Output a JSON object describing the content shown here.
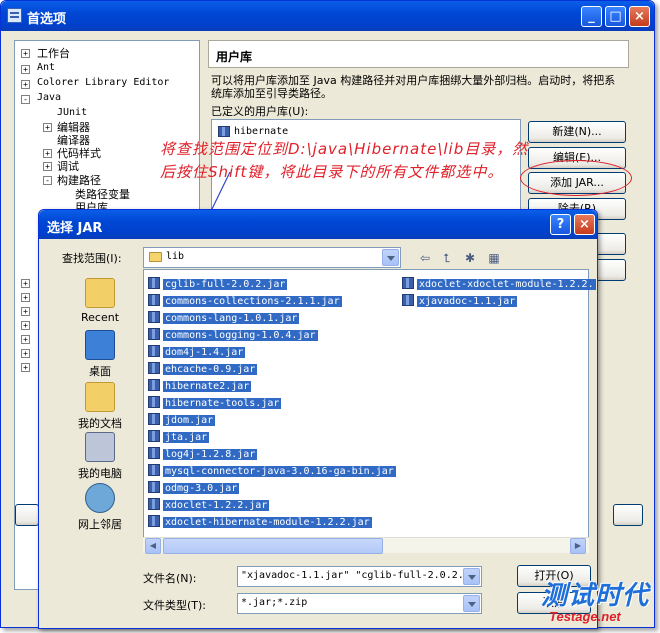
{
  "outer_window": {
    "title": "首选项",
    "tree": [
      {
        "label": "工作台",
        "expander": "+"
      },
      {
        "label": "Ant",
        "expander": "+"
      },
      {
        "label": "Colorer Library Editor",
        "expander": "+"
      },
      {
        "label": "Java",
        "expander": "-"
      },
      {
        "label": "JUnit",
        "expander": ""
      },
      {
        "label": "编辑器",
        "expander": "+"
      },
      {
        "label": "编译器",
        "expander": ""
      },
      {
        "label": "代码样式",
        "expander": "+"
      },
      {
        "label": "调试",
        "expander": "+"
      },
      {
        "label": "构建路径",
        "expander": "-"
      },
      {
        "label": "类路径变量",
        "expander": ""
      },
      {
        "label": "用户库",
        "expander": ""
      }
    ],
    "page_title": "用户库",
    "description": "可以将用户库添加至 Java 构建路径并对用户库捆绑大量外部归档。启动时，将把系统库添加至引导类路径。",
    "defined_libs_label": "已定义的用户库(U):",
    "libraries": [
      "hibernate"
    ],
    "buttons": {
      "new": "新建(N)...",
      "edit": "编辑(E)...",
      "add_jar": "添加 JAR...",
      "remove": "除去(R)"
    }
  },
  "annotation": {
    "text": "将查找范围定位到D:\\java\\Hibernate\\lib目录，然后按住Shift键，将此目录下的所有文件都选中。"
  },
  "dialog": {
    "title": "选择 JAR",
    "look_in_label": "查找范围(I):",
    "look_in_value": "lib",
    "places": [
      "Recent",
      "桌面",
      "我的文档",
      "我的电脑",
      "网上邻居"
    ],
    "files_col1": [
      "cglib-full-2.0.2.jar",
      "commons-collections-2.1.1.jar",
      "commons-lang-1.0.1.jar",
      "commons-logging-1.0.4.jar",
      "dom4j-1.4.jar",
      "ehcache-0.9.jar",
      "hibernate2.jar",
      "hibernate-tools.jar",
      "jdom.jar",
      "jta.jar",
      "log4j-1.2.8.jar",
      "mysql-connector-java-3.0.16-ga-bin.jar",
      "odmg-3.0.jar",
      "xdoclet-1.2.2.jar",
      "xdoclet-hibernate-module-1.2.2.jar"
    ],
    "files_col2": [
      "xdoclet-xdoclet-module-1.2.2.",
      "xjavadoc-1.1.jar"
    ],
    "filename_label": "文件名(N):",
    "filename_value": "\"xjavadoc-1.1.jar\" \"cglib-full-2.0.2.",
    "filetype_label": "文件类型(T):",
    "filetype_value": "*.jar;*.zip",
    "open_button": "打开(O)",
    "cancel_button": "取消"
  },
  "watermark": {
    "line1": "测试时代",
    "line2": "Testage.net"
  },
  "colors": {
    "titlebar": "#0047d5",
    "selection": "#316ac5",
    "annotation": "#e0202a"
  }
}
